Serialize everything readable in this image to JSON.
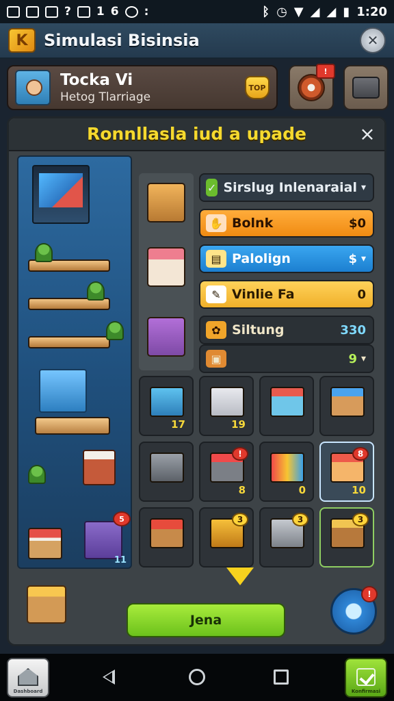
{
  "status_bar": {
    "left_icons": [
      "photo-icon",
      "chart-icon",
      "mail-icon",
      "help-icon",
      "message-icon",
      "notification-icon",
      "sync-icon",
      "gamepad-icon",
      "more-icon"
    ],
    "left_glyphs": [
      "?",
      "1",
      "6",
      ":"
    ],
    "time": "1:20"
  },
  "header": {
    "title": "Simulasi Bisinsia",
    "logo_glyph": "K"
  },
  "store_card": {
    "name": "Tocka Vi",
    "subtitle": "Hetog Tlarriage",
    "badge": "TOP"
  },
  "quick_actions": [
    {
      "name": "reward-disc",
      "alert": "!"
    },
    {
      "name": "storage-box",
      "alert": ""
    }
  ],
  "modal": {
    "title": "Ronnllasla iud a upade",
    "close": "×",
    "rows": [
      {
        "label": "Sirslug Inlenaraial",
        "value": "",
        "icon": "✓",
        "chevron": "▾"
      },
      {
        "label": "Bolnk",
        "value": "$0",
        "icon": "✋",
        "chevron": ""
      },
      {
        "label": "Palolign",
        "value": "$",
        "icon": "▤",
        "chevron": "▾"
      },
      {
        "label": "Vinlie Fa",
        "value": "0",
        "icon": "✎",
        "chevron": ""
      },
      {
        "label": "Siltung",
        "value": "330",
        "icon": "✿",
        "chevron": ""
      },
      {
        "label": "",
        "value": "9",
        "icon": "▣",
        "chevron": "▾"
      }
    ],
    "grid_cells": [
      {
        "art": "a-blue",
        "num": "17",
        "badge": "",
        "badge_style": ""
      },
      {
        "art": "a-white",
        "num": "19",
        "badge": "",
        "badge_style": ""
      },
      {
        "art": "a-store",
        "num": "",
        "badge": "",
        "badge_style": ""
      },
      {
        "art": "a-stall",
        "num": "",
        "badge": "",
        "badge_style": ""
      },
      {
        "art": "a-grey",
        "num": "",
        "badge": "",
        "badge_style": ""
      },
      {
        "art": "a-cart",
        "num": "8",
        "badge": "!",
        "badge_style": "cb-red"
      },
      {
        "art": "a-mix",
        "num": "0",
        "badge": "",
        "badge_style": ""
      },
      {
        "art": "a-shop",
        "num": "10",
        "badge": "8",
        "badge_style": "cb-red"
      },
      {
        "art": "a-red",
        "num": "",
        "badge": "",
        "badge_style": ""
      },
      {
        "art": "a-cash",
        "num": "",
        "badge": "3",
        "badge_style": "cb-yel"
      },
      {
        "art": "a-silver",
        "num": "",
        "badge": "3",
        "badge_style": "cb-yel"
      },
      {
        "art": "a-fruit",
        "num": "",
        "badge": "3",
        "badge_style": "cb-yel"
      }
    ],
    "scene_num": "11",
    "scene_badge": "5",
    "cta_label": "Jena",
    "search_badge": "!"
  },
  "nav": {
    "home_label": "Dashboard",
    "confirm_label": "Konfirmasi"
  },
  "colors": {
    "accent_yellow": "#f5d92e",
    "cta_green": "#6cc11c",
    "row_orange": "#f08b12",
    "row_blue": "#1c7fd0"
  }
}
